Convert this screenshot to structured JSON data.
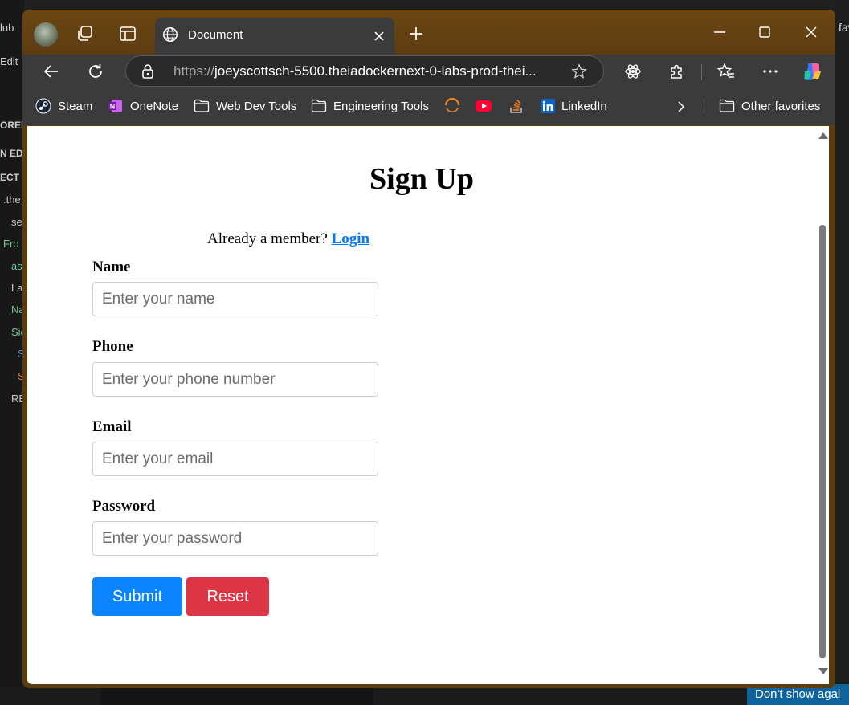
{
  "background": {
    "left_panel_fragments": [
      "lub",
      "Edit",
      "ORER",
      "N EDI",
      "ECT",
      ".the",
      "se",
      "Fro",
      "as",
      "La",
      "Na",
      "Sic",
      "S",
      "S",
      "RE"
    ],
    "right_fragment": "fav",
    "notification_text": "Don't show agai"
  },
  "browser": {
    "tab_title": "Document",
    "address": {
      "scheme": "https://",
      "rest": "joeyscottsch-5500.theiadockernext-0-labs-prod-thei..."
    },
    "favorites": [
      {
        "label": "Steam",
        "icon": "steam-icon"
      },
      {
        "label": "OneNote",
        "icon": "onenote-icon"
      },
      {
        "label": "Web Dev Tools",
        "icon": "folder-icon"
      },
      {
        "label": "Engineering Tools",
        "icon": "folder-icon"
      },
      {
        "label": "",
        "icon": "loader-icon"
      },
      {
        "label": "",
        "icon": "youtube-icon"
      },
      {
        "label": "",
        "icon": "stackoverflow-icon"
      },
      {
        "label": "LinkedIn",
        "icon": "linkedin-icon"
      }
    ],
    "other_favorites": "Other favorites"
  },
  "page": {
    "heading": "Sign Up",
    "member_text": "Already a member?",
    "login_link": "Login",
    "fields": [
      {
        "label": "Name",
        "placeholder": "Enter your name"
      },
      {
        "label": "Phone",
        "placeholder": "Enter your phone number"
      },
      {
        "label": "Email",
        "placeholder": "Enter your email"
      },
      {
        "label": "Password",
        "placeholder": "Enter your password"
      }
    ],
    "submit_label": "Submit",
    "reset_label": "Reset"
  },
  "colors": {
    "titlebar": "#6b4612",
    "submit": "#0a84ff",
    "reset": "#dc3545",
    "link": "#007bff"
  }
}
